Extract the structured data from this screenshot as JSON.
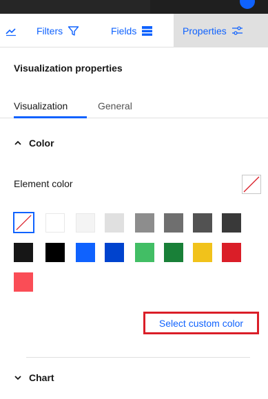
{
  "tabs": {
    "filters_label": "Filters",
    "fields_label": "Fields",
    "properties_label": "Properties"
  },
  "panel": {
    "title": "Visualization properties",
    "subtabs": {
      "visualization": "Visualization",
      "general": "General"
    }
  },
  "color_section": {
    "header": "Color",
    "element_color_label": "Element color",
    "palette": [
      {
        "name": "none",
        "color": "none"
      },
      {
        "name": "white",
        "color": "#ffffff"
      },
      {
        "name": "gray-10",
        "color": "#f4f4f4"
      },
      {
        "name": "gray-20",
        "color": "#e0e0e0"
      },
      {
        "name": "gray-50",
        "color": "#8d8d8d"
      },
      {
        "name": "gray-60",
        "color": "#6f6f6f"
      },
      {
        "name": "gray-70",
        "color": "#525252"
      },
      {
        "name": "gray-80",
        "color": "#393939"
      },
      {
        "name": "gray-100",
        "color": "#161616"
      },
      {
        "name": "black",
        "color": "#000000"
      },
      {
        "name": "blue-60",
        "color": "#0f62fe"
      },
      {
        "name": "blue-70",
        "color": "#0043ce"
      },
      {
        "name": "green-40",
        "color": "#42be65"
      },
      {
        "name": "green-60",
        "color": "#198038"
      },
      {
        "name": "yellow",
        "color": "#f1c21b"
      },
      {
        "name": "red-60",
        "color": "#da1e28"
      },
      {
        "name": "red-50",
        "color": "#fa4d56"
      }
    ],
    "selected_index": 0,
    "custom_color_button": "Select custom color"
  },
  "chart_section": {
    "header": "Chart"
  },
  "colors": {
    "accent": "#0f62fe",
    "highlight_box": "#da1e28"
  }
}
